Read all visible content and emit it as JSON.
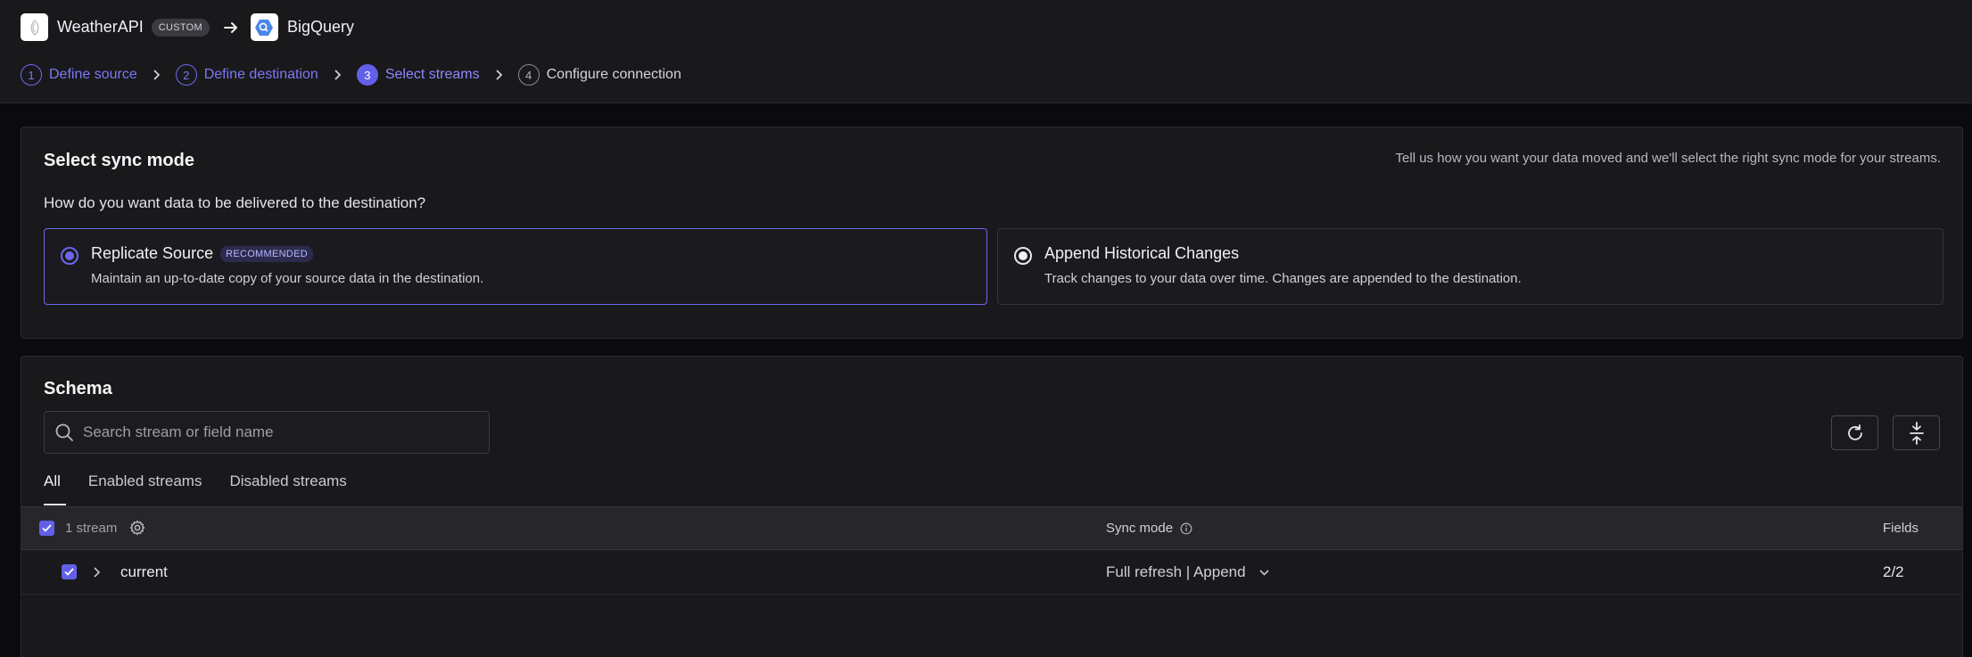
{
  "header": {
    "source_name": "WeatherAPI",
    "source_badge": "CUSTOM",
    "destination_name": "BigQuery",
    "steps": [
      {
        "number": "1",
        "label": "Define source"
      },
      {
        "number": "2",
        "label": "Define destination"
      },
      {
        "number": "3",
        "label": "Select streams"
      },
      {
        "number": "4",
        "label": "Configure connection"
      }
    ],
    "active_step": 3
  },
  "sync_mode": {
    "title": "Select sync mode",
    "hint": "Tell us how you want your data moved and we'll select the right sync mode for your streams.",
    "question": "How do you want data to be delivered to the destination?",
    "options": [
      {
        "title": "Replicate Source",
        "badge": "RECOMMENDED",
        "description": "Maintain an up-to-date copy of your source data in the destination.",
        "selected": true
      },
      {
        "title": "Append Historical Changes",
        "description": "Track changes to your data over time. Changes are appended to the destination.",
        "selected": false
      }
    ]
  },
  "schema": {
    "title": "Schema",
    "search_placeholder": "Search stream or field name",
    "tabs": [
      "All",
      "Enabled streams",
      "Disabled streams"
    ],
    "active_tab": "All",
    "table": {
      "stream_count": "1 stream",
      "sync_mode_header": "Sync mode",
      "fields_header": "Fields",
      "rows": [
        {
          "name": "current",
          "sync_mode": "Full refresh | Append",
          "fields": "2/2",
          "enabled": true
        }
      ]
    }
  },
  "colors": {
    "accent": "#6360e8",
    "background": "#0b0b0d",
    "panel": "#19191c"
  }
}
